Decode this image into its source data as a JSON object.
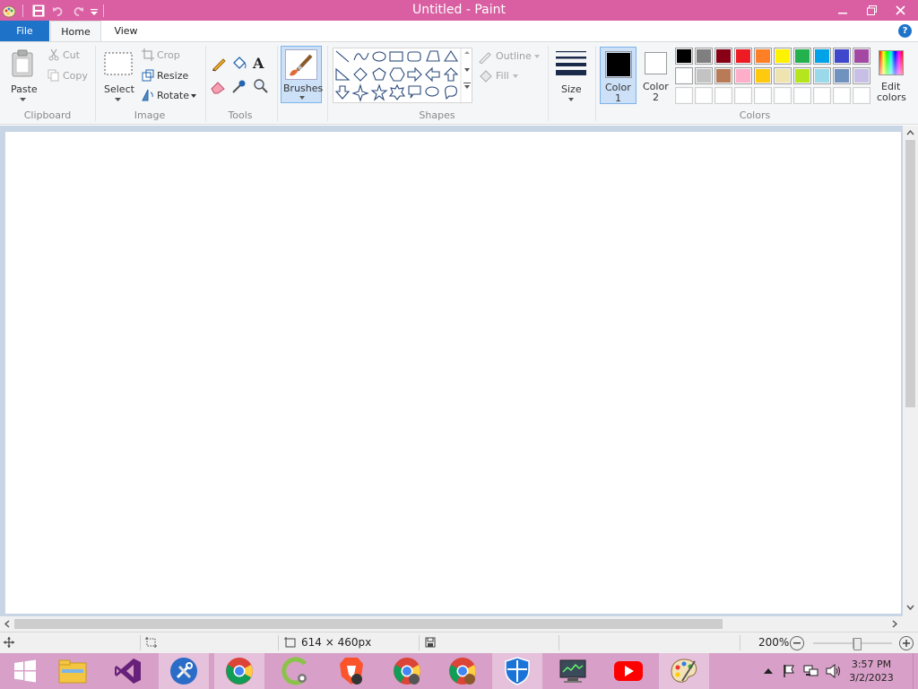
{
  "window": {
    "title": "Untitled - Paint",
    "accent": "#d95fa2"
  },
  "tabs": {
    "file": "File",
    "home": "Home",
    "view": "View"
  },
  "help": "?",
  "clipboard": {
    "paste": "Paste",
    "cut": "Cut",
    "copy": "Copy",
    "label": "Clipboard"
  },
  "image": {
    "select": "Select",
    "crop": "Crop",
    "resize": "Resize",
    "rotate": "Rotate",
    "label": "Image"
  },
  "tools": {
    "label": "Tools",
    "text_glyph": "A"
  },
  "brushes": {
    "label": "Brushes"
  },
  "shapes": {
    "outline": "Outline",
    "fill": "Fill",
    "label": "Shapes"
  },
  "size": {
    "label": "Size"
  },
  "colors": {
    "color1": "Color",
    "color1_num": "1",
    "color2": "Color",
    "color2_num": "2",
    "edit": "Edit",
    "edit2": "colors",
    "label": "Colors",
    "color1_value": "#000000",
    "color2_value": "#ffffff",
    "palette_row1": [
      "#000000",
      "#7f7f7f",
      "#880015",
      "#ed1c24",
      "#ff7f27",
      "#fff200",
      "#22b14c",
      "#00a2e8",
      "#3f48cc",
      "#a349a4"
    ],
    "palette_row2": [
      "#ffffff",
      "#c3c3c3",
      "#b97a57",
      "#ffaec9",
      "#ffc90e",
      "#efe4b0",
      "#b5e61d",
      "#99d9ea",
      "#7092be",
      "#c8bfe7"
    ],
    "palette_row3": [
      "#ffffff",
      "#ffffff",
      "#ffffff",
      "#ffffff",
      "#ffffff",
      "#ffffff",
      "#ffffff",
      "#ffffff",
      "#ffffff",
      "#ffffff"
    ]
  },
  "status": {
    "dimensions": "614 × 460px",
    "zoom": "200%",
    "zoom_level": 0.5
  },
  "taskbar": {
    "apps": [
      "start-button",
      "file-explorer",
      "visual-studio",
      "tools-app",
      "chrome",
      "ccleaner",
      "brave",
      "chrome-profile-2",
      "chrome-profile-3",
      "windows-defender",
      "system-monitor",
      "youtube",
      "paint"
    ],
    "time": "3:57 PM",
    "date": "3/2/2023"
  }
}
